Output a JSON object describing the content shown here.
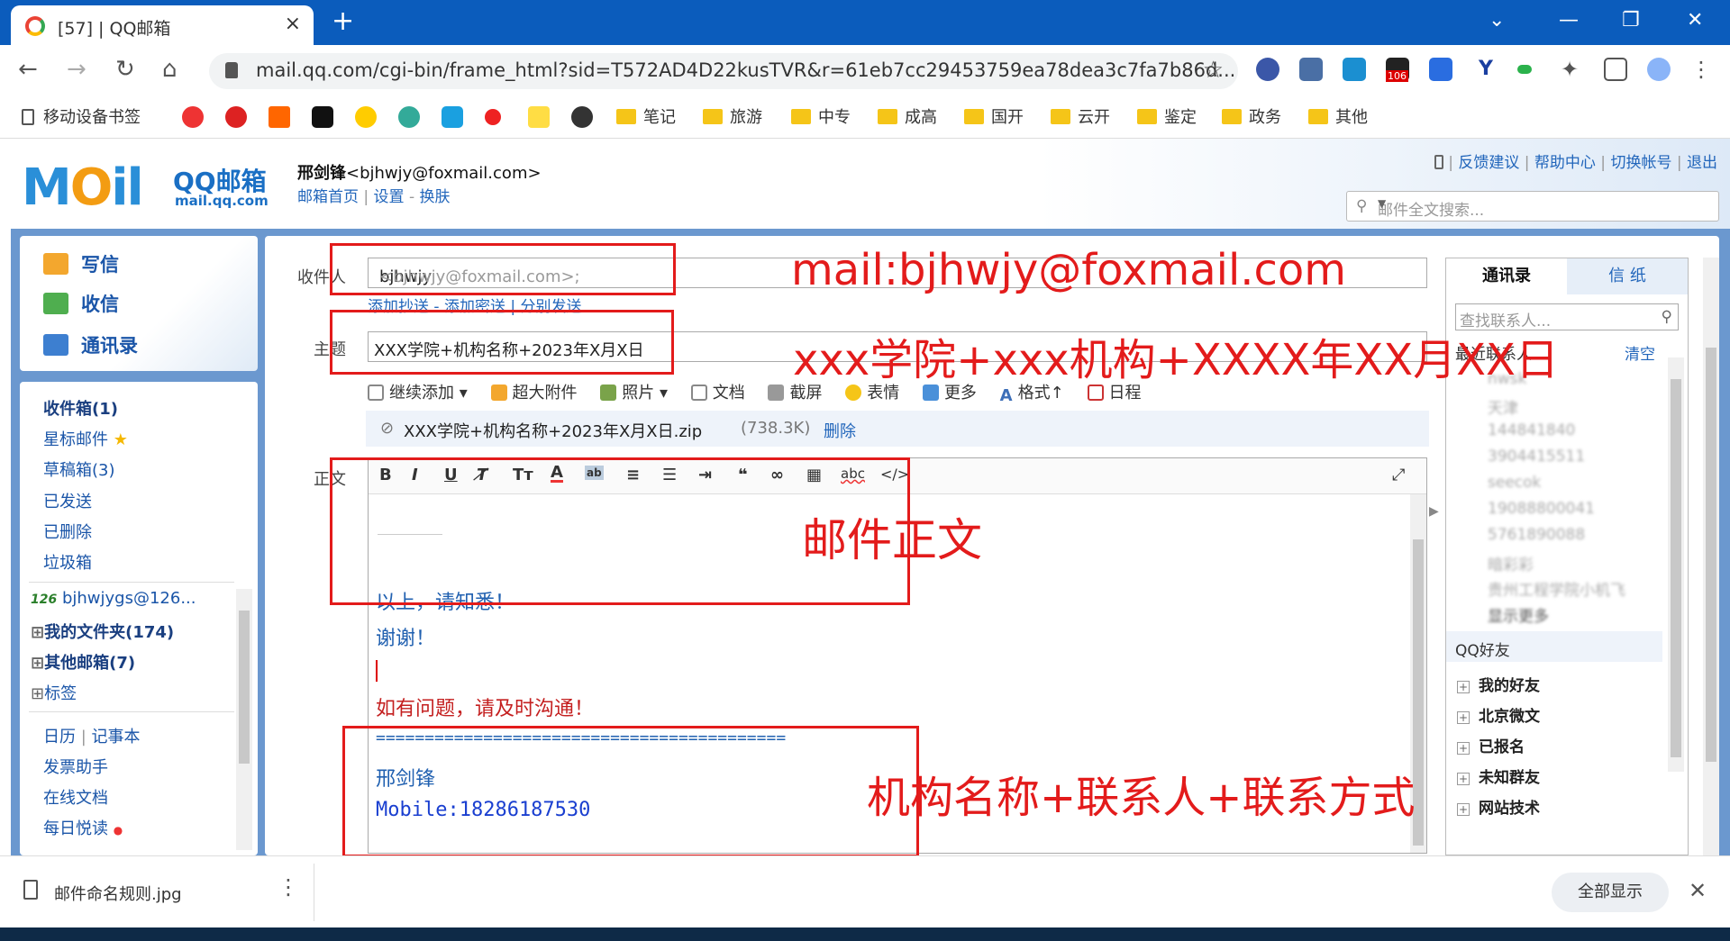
{
  "browser": {
    "tab_title": "[57] | QQ邮箱",
    "tab_close": "×",
    "new_tab": "+",
    "url": "mail.qq.com/cgi-bin/frame_html?sid=T572AD4D22kusTVR&r=61eb7cc29453759ea78dea3c7fa7b86d...",
    "ext_badge": "106",
    "bookmarks": [
      "移动设备书签",
      "笔记",
      "旅游",
      "中专",
      "成高",
      "国开",
      "云开",
      "鉴定",
      "政务",
      "其他"
    ]
  },
  "mail_header": {
    "logo": "MOil",
    "logo_text": "QQ邮箱",
    "logo_url": "mail.qq.com",
    "user_name": "邢剑锋",
    "user_email": "<bjhwjy@foxmail.com>",
    "home_link": "邮箱首页",
    "settings_link": "设置",
    "skin_link": "换肤",
    "top_links": [
      "反馈建议",
      "帮助中心",
      "切换帐号",
      "退出"
    ],
    "search_placeholder": "邮件全文搜索..."
  },
  "quick_actions": [
    "写信",
    "收信",
    "通讯录"
  ],
  "folders": {
    "inbox": "收件箱(1)",
    "starred": "星标邮件",
    "drafts": "草稿箱(3)",
    "sent": "已发送",
    "deleted": "已删除",
    "spam": "垃圾箱",
    "external_account": "bjhwjygs@126...",
    "my_folders": "我的文件夹(174)",
    "other_mailboxes": "其他邮箱(7)",
    "tags": "标签",
    "calendar": "日历",
    "notepad": "记事本",
    "invoice": "发票助手",
    "docs": "在线文档",
    "daily": "每日悦读"
  },
  "compose": {
    "to_label": "收件人",
    "to_value": "bjhwjy",
    "to_addr": "<bjhwjy@foxmail.com>;",
    "cc_links": "添加抄送 - 添加密送 | 分别发送",
    "subject_label": "主题",
    "subject_value": "XXX学院+机构名称+2023年X月X日",
    "attach_tools": [
      "继续添加",
      "超大附件",
      "照片",
      "文档",
      "截屏",
      "表情",
      "更多",
      "格式↑",
      "日程"
    ],
    "attachment_name": "XXX学院+机构名称+2023年X月X日.zip",
    "attachment_size": "(738.3K)",
    "attachment_delete": "删除",
    "body_label": "正文",
    "body_lines": [
      "以上，请知悉！",
      "谢谢！",
      "如有问题，请及时沟通！",
      "==========================================",
      "邢剑锋",
      "Mobile:18286187530"
    ]
  },
  "contacts": {
    "tab_contacts": "通讯录",
    "tab_stationery": "信 纸",
    "search_placeholder": "查找联系人...",
    "recent_label": "最近联系人",
    "clear_label": "清空",
    "recent_items": [
      "nwsk",
      "天津",
      "144841840",
      "3904415511",
      "seecok",
      "19088800041",
      "5761890088",
      "暗彩彩",
      "贵州工程学院小机飞"
    ],
    "show_more": "显示更多",
    "qq_friends": "QQ好友",
    "groups": [
      "我的好友",
      "北京微文",
      "已报名",
      "未知群友",
      "网站技术"
    ]
  },
  "annotations": {
    "to": "mail:bjhwjy@foxmail.com",
    "subject": "xxx学院+xxx机构+XXXX年XX月XX日",
    "body": "邮件正文",
    "signature": "机构名称+联系人+联系方式"
  },
  "download_bar": {
    "file_name": "邮件命名规则.jpg",
    "show_all": "全部显示"
  }
}
